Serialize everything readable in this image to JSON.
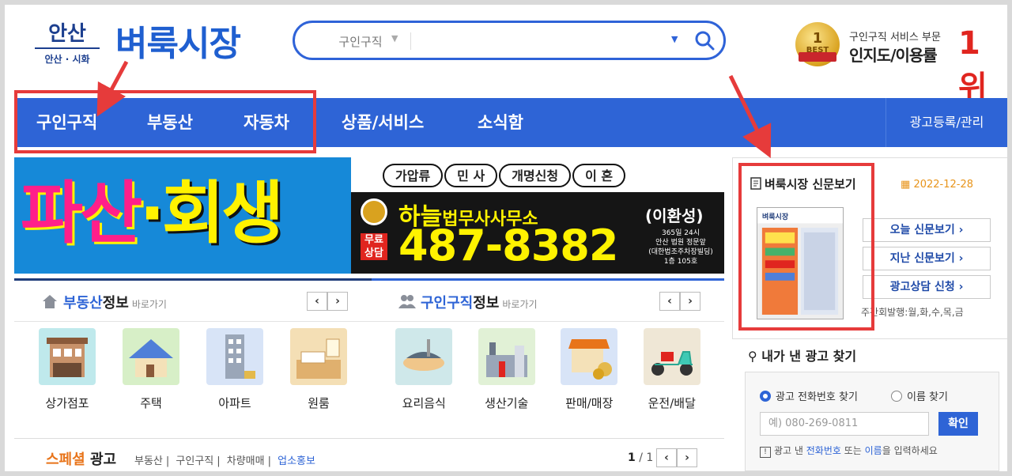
{
  "header": {
    "logo_city": "안산",
    "logo_sub": "안산 · 시화",
    "brand": "벼룩시장",
    "search": {
      "category": "구인구직",
      "placeholder": ""
    },
    "badge": {
      "medal_num": "1",
      "medal_text": "BEST",
      "line1": "구인구직 서비스 부문",
      "line2": "인지도/이용률",
      "rank": "1위"
    }
  },
  "nav": {
    "items": [
      "구인구직",
      "부동산",
      "자동차",
      "상품/서비스",
      "소식함"
    ],
    "right": "광고등록/관리"
  },
  "banner": {
    "left_a": "파산",
    "left_dot": "·",
    "left_b": "회생",
    "pills": [
      "가압류",
      "민 사",
      "개명신청",
      "이 혼"
    ],
    "office_a": "하늘",
    "office_b": "법무사사무소",
    "name": "(이환성)",
    "free": [
      "무료",
      "상담"
    ],
    "phone": "487-8382",
    "info": [
      "365일 24시",
      "안산 법원 정문앞",
      "(대한법조주차장빌딩)",
      "1층 105호"
    ]
  },
  "realestate": {
    "title_hl": "부동산",
    "title_rest": "정보",
    "sub": "바로가기",
    "items": [
      "상가점포",
      "주택",
      "아파트",
      "원룸"
    ]
  },
  "jobs": {
    "title_hl": "구인구직",
    "title_rest": "정보",
    "sub": "바로가기",
    "items": [
      "요리음식",
      "생산기술",
      "판매/매장",
      "운전/배달"
    ]
  },
  "special": {
    "title_o": "스페셜",
    "title_rest": " 광고",
    "links": [
      "부동산",
      "구인구직",
      "차량매매",
      "업소홍보"
    ],
    "page_cur": "1",
    "page_total": "/ 1"
  },
  "newspaper": {
    "title": "벼룩시장 신문보기",
    "date": "2022-12-28",
    "thumb_label": "벼룩시장",
    "buttons": [
      "오늘 신문보기 ›",
      "지난 신문보기 ›",
      "광고상담 신청 ›"
    ],
    "note": "주간회발행:월,화,수,목,금"
  },
  "find": {
    "title": "내가 낸 광고 찾기",
    "radio_phone": "광고 전화번호 찾기",
    "radio_name": "이름 찾기",
    "phone_placeholder": "예) 080-269-0811",
    "ok": "확인",
    "hint_a": "광고 낸 ",
    "hint_b": "전화번호",
    "hint_c": " 또는 ",
    "hint_d": "이름",
    "hint_e": "을 입력하세요"
  },
  "colors": {
    "brand_blue": "#2e64d6",
    "annotation_red": "#e63b3b",
    "accent_orange": "#e8741a"
  }
}
